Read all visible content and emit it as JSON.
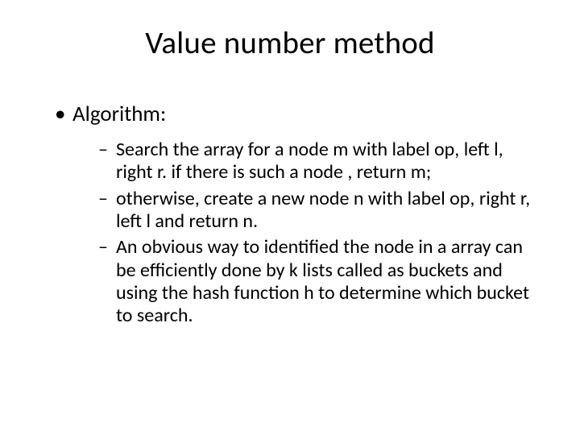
{
  "title": "Value number method",
  "bullets": [
    {
      "text": "Algorithm:",
      "children": [
        "Search the array for a node  m with label op, left l, right r. if there is such a node , return m;",
        "otherwise, create a new node n with label op, right r, left l and return n.",
        "An obvious way to identified the node in a array can be efficiently done by k lists called as buckets and using the hash function  h to determine which bucket to search."
      ]
    }
  ]
}
